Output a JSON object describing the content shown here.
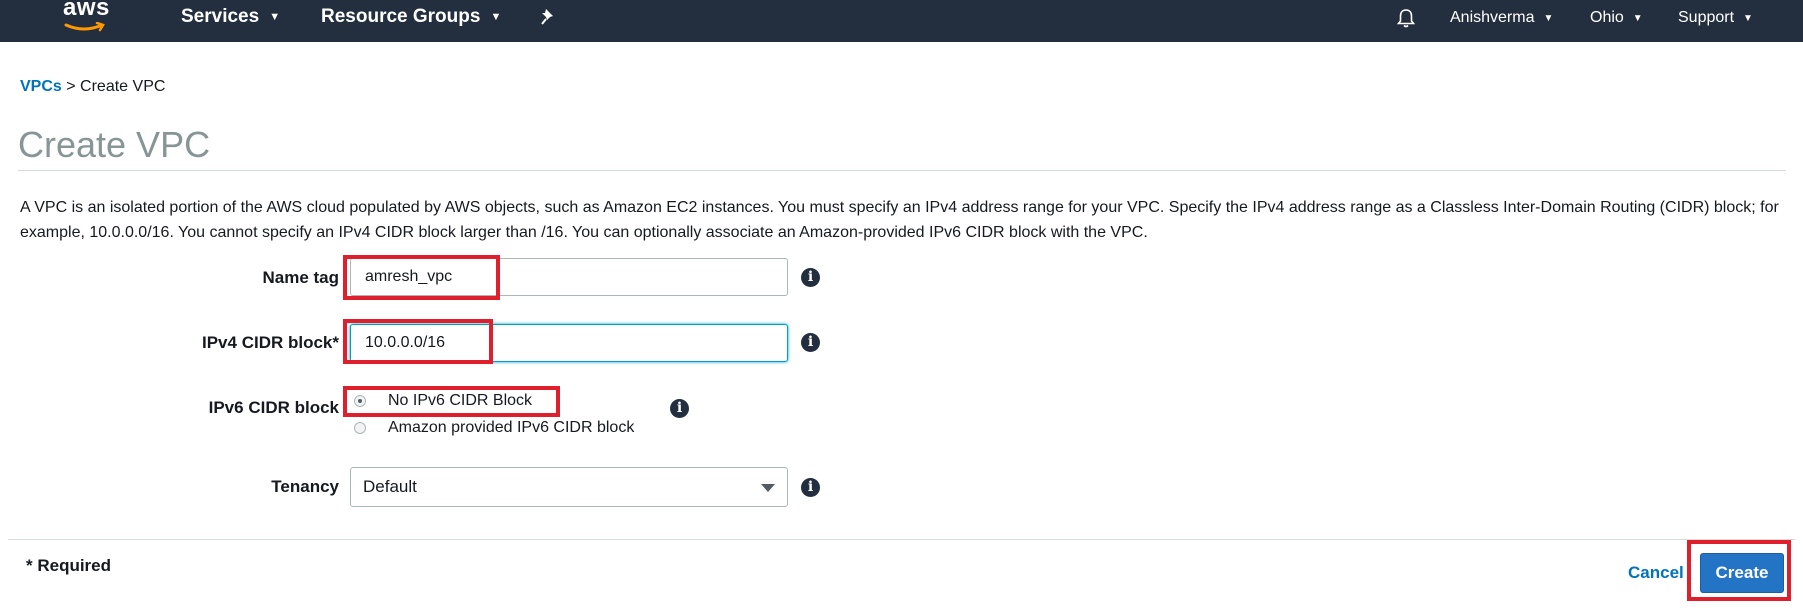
{
  "nav": {
    "logo_text": "aws",
    "services_label": "Services",
    "resource_groups_label": "Resource Groups",
    "username": "Anishverma",
    "region": "Ohio",
    "support_label": "Support"
  },
  "breadcrumb": {
    "parent_label": "VPCs",
    "separator": ">",
    "current_label": "Create VPC"
  },
  "page": {
    "title": "Create VPC",
    "description": "A VPC is an isolated portion of the AWS cloud populated by AWS objects, such as Amazon EC2 instances. You must specify an IPv4 address range for your VPC. Specify the IPv4 address range as a Classless Inter-Domain Routing (CIDR) block; for example, 10.0.0.0/16. You cannot specify an IPv4 CIDR block larger than /16. You can optionally associate an Amazon-provided IPv6 CIDR block with the VPC."
  },
  "form": {
    "name_tag": {
      "label": "Name tag",
      "value": "amresh_vpc"
    },
    "ipv4_cidr": {
      "label": "IPv4 CIDR block*",
      "value": "10.0.0.0/16"
    },
    "ipv6_cidr": {
      "label": "IPv6 CIDR block",
      "options": [
        {
          "label": "No IPv6 CIDR Block",
          "selected": true
        },
        {
          "label": "Amazon provided IPv6 CIDR block",
          "selected": false
        }
      ]
    },
    "tenancy": {
      "label": "Tenancy",
      "value": "Default"
    }
  },
  "footer": {
    "required_note": "* Required",
    "cancel_label": "Cancel",
    "create_label": "Create"
  },
  "colors": {
    "nav_background": "#232f3e",
    "link_blue": "#0073bb",
    "primary_button": "#2474c6",
    "highlight_red": "#e01f2d"
  }
}
